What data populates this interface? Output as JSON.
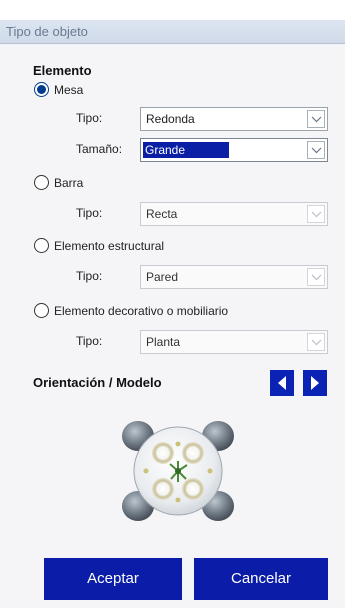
{
  "window": {
    "title": "Tipo de objeto"
  },
  "section": {
    "heading": "Elemento"
  },
  "options": [
    {
      "label": "Mesa",
      "checked": true
    },
    {
      "label": "Barra",
      "checked": false
    },
    {
      "label": "Elemento estructural",
      "checked": false
    },
    {
      "label": "Elemento decorativo o mobiliario",
      "checked": false
    }
  ],
  "fields": {
    "mesa_tipo": {
      "label": "Tipo:",
      "value": "Redonda"
    },
    "mesa_tamano": {
      "label": "Tamaño:",
      "value": "Grande"
    },
    "barra_tipo": {
      "label": "Tipo:",
      "value": "Recta"
    },
    "estructural_tipo": {
      "label": "Tipo:",
      "value": "Pared"
    },
    "decorativo_tipo": {
      "label": "Tipo:",
      "value": "Planta"
    }
  },
  "orientation": {
    "heading": "Orientación / Modelo",
    "prev_icon": "triangle-left-icon",
    "next_icon": "triangle-right-icon"
  },
  "buttons": {
    "accept": "Aceptar",
    "cancel": "Cancelar"
  },
  "colors": {
    "accent": "#0a1ca8",
    "selection": "#0a1fa6",
    "radio": "#003b8e"
  }
}
